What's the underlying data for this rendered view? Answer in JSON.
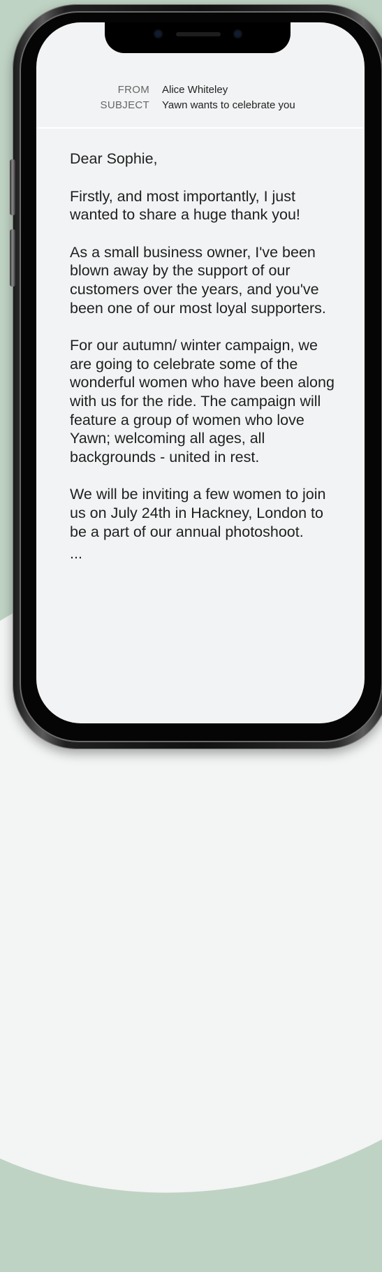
{
  "email": {
    "from_label": "FROM",
    "from_value": "Alice Whiteley",
    "subject_label": "SUBJECT",
    "subject_value": "Yawn wants to celebrate you",
    "greeting": "Dear Sophie,",
    "paragraphs": [
      "Firstly, and most importantly, I just wanted to share a huge thank you!",
      "As a small business owner, I've been blown away by the support of our customers over the years, and you've been one of our most loyal supporters.",
      "For our autumn/ winter campaign, we are going to celebrate some of the wonderful women who have been along with us for the ride. The campaign will feature a group of women who love Yawn; welcoming all ages, all backgrounds - united in rest.",
      "We will be inviting a few women to join us on July 24th in Hackney, London to be a part of our annual photoshoot."
    ],
    "ellipsis": "..."
  },
  "icons": {
    "camera": "front-camera-icon",
    "speaker": "earpiece-speaker-icon"
  },
  "colors": {
    "background": "#bfd3c4",
    "screen": "#f2f3f4",
    "text": "#1f1f1f"
  }
}
